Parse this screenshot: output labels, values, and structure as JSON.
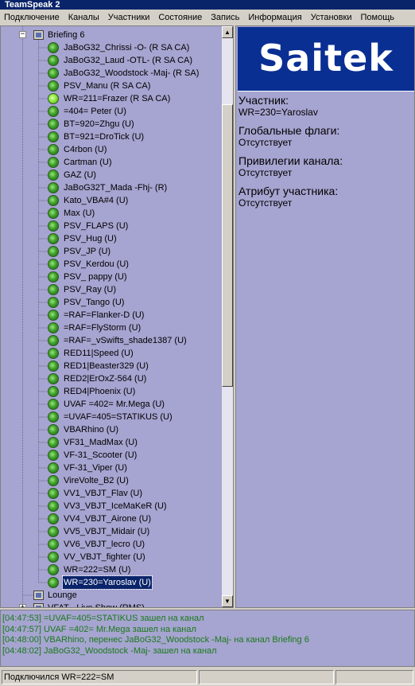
{
  "window": {
    "title": "TeamSpeak 2"
  },
  "menu": [
    "Подключение",
    "Каналы",
    "Участники",
    "Состояние",
    "Запись",
    "Информация",
    "Установки",
    "Помощь"
  ],
  "tree": {
    "current_channel": "Briefing 6",
    "users": [
      "JaBoG32_Chrissi -O-  (R SA CA)",
      "JaBoG32_Laud -OTL-  (R SA CA)",
      "JaBoG32_Woodstock -Maj-  (R SA)",
      "PSV_Manu  (R SA CA)",
      "WR=211=Frazer  (R SA CA)",
      "=404= Peter  (U)",
      "BT=920=Zhgu  (U)",
      "BT=921=DroTick  (U)",
      "C4rbon  (U)",
      "Cartman  (U)",
      "GAZ  (U)",
      "JaBoG32T_Mada -Fhj-  (R)",
      "Kato_VBA#4  (U)",
      "Max  (U)",
      "PSV_FLAPS  (U)",
      "PSV_Hug  (U)",
      "PSV_JP  (U)",
      "PSV_Kerdou  (U)",
      "PSV_ pappy  (U)",
      "PSV_Ray  (U)",
      "PSV_Tango  (U)",
      "=RAF=Flanker-D  (U)",
      "=RAF=FlyStorm  (U)",
      "=RAF=_vSwifts_shade1387  (U)",
      "RED11|Speed  (U)",
      "RED1|Beaster329  (U)",
      "RED2|ErOxZ-564  (U)",
      "RED4|Phoenix  (U)",
      "UVAF =402= Mr.Mega  (U)",
      "=UVAF=405=STATIKUS  (U)",
      "VBARhino  (U)",
      "VF31_MadMax  (U)",
      "VF-31_Scooter  (U)",
      "VF-31_Viper  (U)",
      "VireVolte_B2  (U)",
      "VV1_VBJT_Flav  (U)",
      "VV3_VBJT_IceMaKeR  (U)",
      "VV4_VBJT_Airone  (U)",
      "VV5_VBJT_Midair  (U)",
      "VV6_VBJT_lecro  (U)",
      "VV_VBJT_fighter  (U)",
      "WR=222=SM  (U)",
      "WR=230=Yaroslav  (U)"
    ],
    "lounge": "Lounge",
    "next_channel": "VFAT - Live Show    (RMS)"
  },
  "info": {
    "logo": "Saitek",
    "participant_label": "Участник:",
    "participant_value": "WR=230=Yaroslav",
    "global_flags_label": "Глобальные флаги:",
    "global_flags_value": "Отсутствует",
    "channel_privileges_label": "Привилегии канала:",
    "channel_privileges_value": "Отсутствует",
    "participant_attribute_label": "Атрибут участника:",
    "participant_attribute_value": "Отсутствует"
  },
  "log": [
    "[04:47:53] =UVAF=405=STATIKUS  зашел на канал",
    "[04:47:57] UVAF =402= Mr.Mega зашел на канал",
    "[04:48:00] VBARhino, перенес JaBoG32_Woodstock -Maj- на канал Briefing 6",
    "[04:48:02] JaBoG32_Woodstock -Maj-  зашел на канал"
  ],
  "status": {
    "connected_as": "Подключился WR=222=SM"
  },
  "colors": {
    "panel_bg": "#a6a4d0",
    "title_bg": "#0a246a",
    "logo_bg": "#0a2f93",
    "log_text": "#1a7a1a",
    "selection_bg": "#0a246a",
    "voice_indicator": "#8ee83a"
  },
  "icons": {
    "channel": "channel-icon",
    "user": "user-status-icon",
    "expander": "expander-icon"
  }
}
